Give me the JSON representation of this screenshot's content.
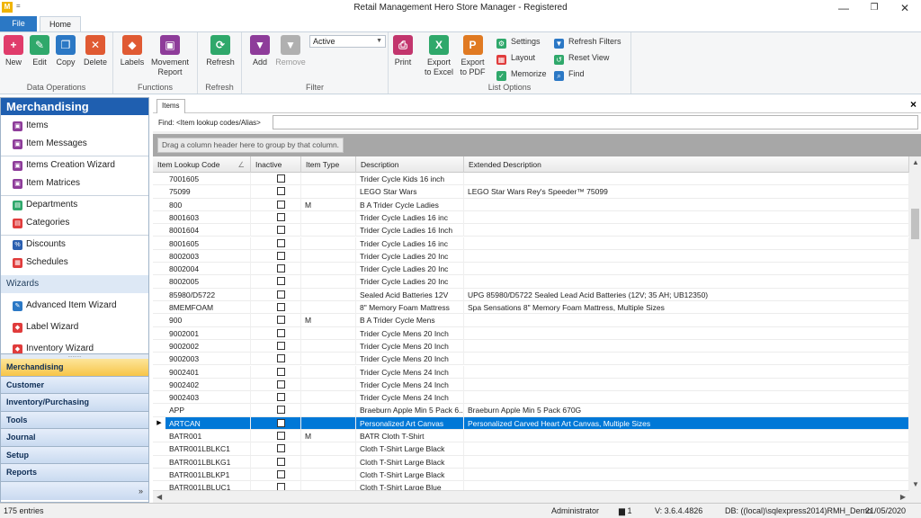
{
  "app": {
    "logo": "M",
    "qat": "=",
    "title": "Retail Management Hero Store Manager - Registered",
    "controls": {
      "minimize": "—",
      "restore": "❐",
      "close": "✕"
    }
  },
  "tabs": {
    "file": "File",
    "home": "Home"
  },
  "ribbon": {
    "data_ops": {
      "label": "Data Operations",
      "new": "New",
      "edit": "Edit",
      "copy": "Copy",
      "delete": "Delete"
    },
    "functions": {
      "label": "Functions",
      "labels": "Labels",
      "movement_report": [
        "Movement",
        "Report"
      ]
    },
    "refresh": {
      "label": "Refresh",
      "btn": "Refresh"
    },
    "filter": {
      "label": "Filter",
      "value": "Active",
      "add": "Add",
      "remove": "Remove"
    },
    "list_options": {
      "label": "List Options",
      "print": "Print",
      "export_excel": [
        "Export",
        "to Excel"
      ],
      "export_pdf": [
        "Export",
        "to PDF"
      ],
      "settings": "Settings",
      "layout": "Layout",
      "memorize": "Memorize",
      "refresh_filters": "Refresh Filters",
      "reset_view": "Reset View",
      "find": "Find"
    },
    "colors": {
      "new": "#e03c6b",
      "edit": "#2fa86b",
      "copy": "#2b78c5",
      "delete": "#e05a33",
      "labels": "#e05a33",
      "movement": "#8e3c9a",
      "refresh": "#2fa86b",
      "filter": "#8e3c9a",
      "print": "#c2356d",
      "excel": "#2fa86b",
      "pdf": "#e07a22"
    }
  },
  "nav": {
    "title": "Merchandising",
    "group1": [
      {
        "label": "Items",
        "icon": "items-icon",
        "color": "#8e3c9a"
      },
      {
        "label": "Item Messages",
        "icon": "item-messages-icon",
        "color": "#8e3c9a"
      }
    ],
    "group2": [
      {
        "label": "Items Creation Wizard",
        "icon": "items-creation-wizard-icon",
        "color": "#8e3c9a"
      },
      {
        "label": "Item Matrices",
        "icon": "item-matrices-icon",
        "color": "#8e3c9a"
      }
    ],
    "group3": [
      {
        "label": "Departments",
        "icon": "departments-icon",
        "color": "#2fa86b"
      },
      {
        "label": "Categories",
        "icon": "categories-icon",
        "color": "#e03c3c"
      }
    ],
    "group4": [
      {
        "label": "Discounts",
        "icon": "discounts-icon",
        "color": "#2b5fb0"
      },
      {
        "label": "Schedules",
        "icon": "schedules-icon",
        "color": "#e03c3c"
      }
    ],
    "wizards_header": "Wizards",
    "wizards": [
      {
        "label": "Advanced Item Wizard",
        "icon": "advanced-item-wizard-icon",
        "color": "#2b78c5"
      },
      {
        "label": "Label Wizard",
        "icon": "label-wizard-icon",
        "color": "#e03c3c"
      },
      {
        "label": "Inventory Wizard",
        "icon": "inventory-wizard-icon",
        "color": "#e03c3c"
      }
    ],
    "sections": [
      "Merchandising",
      "Customer",
      "Inventory/Purchasing",
      "Tools",
      "Journal",
      "Setup",
      "Reports"
    ],
    "footer": "»"
  },
  "main": {
    "tab": "Items",
    "close": "×",
    "find_label": "Find: <Item lookup codes/Alias>",
    "find_value": "",
    "group_hint": "Drag a column header here to group by that column.",
    "columns": [
      "Item Lookup Code",
      "Inactive",
      "Item Type",
      "Description",
      "Extended Description"
    ],
    "rows": [
      {
        "code": "7001605",
        "type": "",
        "desc": "Trider Cycle Kids 16 inch",
        "ext": ""
      },
      {
        "code": "75099",
        "type": "",
        "desc": "LEGO Star Wars",
        "ext": "LEGO Star Wars Rey's Speeder™ 75099"
      },
      {
        "code": "800",
        "type": "M",
        "desc": "B A Trider Cycle Ladies",
        "ext": ""
      },
      {
        "code": "8001603",
        "type": "",
        "desc": "Trider Cycle Ladies 16 inc",
        "ext": ""
      },
      {
        "code": "8001604",
        "type": "",
        "desc": "Trider Cycle Ladies 16 Inch",
        "ext": ""
      },
      {
        "code": "8001605",
        "type": "",
        "desc": "Trider Cycle Ladies 16 inc",
        "ext": ""
      },
      {
        "code": "8002003",
        "type": "",
        "desc": "Trider Cycle Ladies 20 Inc",
        "ext": ""
      },
      {
        "code": "8002004",
        "type": "",
        "desc": "Trider Cycle Ladies 20 Inc",
        "ext": ""
      },
      {
        "code": "8002005",
        "type": "",
        "desc": "Trider Cycle Ladies 20 Inc",
        "ext": ""
      },
      {
        "code": "85980/D5722",
        "type": "",
        "desc": "Sealed Acid Batteries 12V",
        "ext": "UPG 85980/D5722 Sealed Lead Acid Batteries (12V; 35 AH; UB12350)"
      },
      {
        "code": "8MEMFOAM",
        "type": "",
        "desc": "8\" Memory Foam Mattress",
        "ext": "Spa Sensations 8\" Memory Foam Mattress, Multiple Sizes"
      },
      {
        "code": "900",
        "type": "M",
        "desc": "B A Trider Cycle Mens",
        "ext": ""
      },
      {
        "code": "9002001",
        "type": "",
        "desc": "Trider Cycle Mens 20 Inch",
        "ext": ""
      },
      {
        "code": "9002002",
        "type": "",
        "desc": "Trider Cycle Mens 20 Inch",
        "ext": ""
      },
      {
        "code": "9002003",
        "type": "",
        "desc": "Trider Cycle Mens 20 Inch",
        "ext": ""
      },
      {
        "code": "9002401",
        "type": "",
        "desc": "Trider Cycle Mens 24 Inch",
        "ext": ""
      },
      {
        "code": "9002402",
        "type": "",
        "desc": "Trider Cycle Mens 24 Inch",
        "ext": ""
      },
      {
        "code": "9002403",
        "type": "",
        "desc": "Trider Cycle Mens 24 Inch",
        "ext": ""
      },
      {
        "code": "APP",
        "type": "",
        "desc": "Braeburn Apple Min 5 Pack 6...",
        "ext": "Braeburn Apple Min 5 Pack 670G"
      },
      {
        "code": "ARTCAN",
        "type": "",
        "desc": "Personalized Art Canvas",
        "ext": "Personalized Carved Heart Art Canvas, Multiple Sizes",
        "selected": true
      },
      {
        "code": "BATR001",
        "type": "M",
        "desc": "BATR Cloth T-Shirt",
        "ext": ""
      },
      {
        "code": "BATR001LBLKC1",
        "type": "",
        "desc": "Cloth T-Shirt Large Black",
        "ext": ""
      },
      {
        "code": "BATR001LBLKG1",
        "type": "",
        "desc": "Cloth T-Shirt Large Black",
        "ext": ""
      },
      {
        "code": "BATR001LBLKP1",
        "type": "",
        "desc": "Cloth T-Shirt Large Black",
        "ext": ""
      },
      {
        "code": "BATR001LBLUC1",
        "type": "",
        "desc": "Cloth T-Shirt Large Blue",
        "ext": ""
      }
    ]
  },
  "status": {
    "entries": "175 entries",
    "user": "Administrator",
    "sessions": "1",
    "version": "V: 3.6.4.4826",
    "db": "DB: ((local)\\sqlexpress2014)RMH_Demo",
    "date": "21/05/2020"
  }
}
